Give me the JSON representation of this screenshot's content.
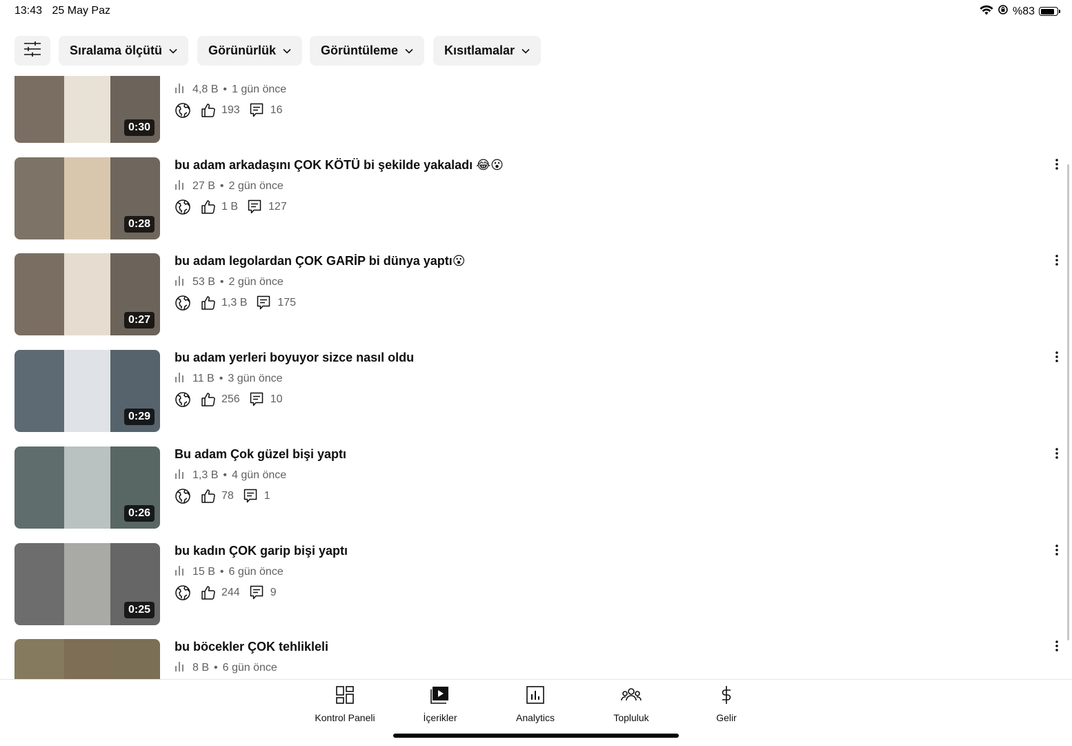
{
  "status_bar": {
    "time": "13:43",
    "date": "25 May Paz",
    "battery": "%83",
    "battery_level": 0.83
  },
  "filters": [
    {
      "label": "Sıralama ölçütü"
    },
    {
      "label": "Görünürlük"
    },
    {
      "label": "Görüntüleme"
    },
    {
      "label": "Kısıtlamalar"
    }
  ],
  "videos": [
    {
      "title": "",
      "duration": "0:30",
      "views": "4,8 B",
      "age": "1 gün önce",
      "likes": "193",
      "comments": "16",
      "thumb_colors": [
        "#7a6e62",
        "#e8e1d6",
        "#6c635a"
      ]
    },
    {
      "title": "bu adam arkadaşını ÇOK KÖTÜ bi şekilde yakaladı 😂😮",
      "duration": "0:28",
      "views": "27 B",
      "age": "2 gün önce",
      "likes": "1 B",
      "comments": "127",
      "thumb_colors": [
        "#7d7366",
        "#d9c7ad",
        "#6f675d"
      ]
    },
    {
      "title": "bu adam legolardan ÇOK GARİP bi dünya yaptı😮",
      "duration": "0:27",
      "views": "53 B",
      "age": "2 gün önce",
      "likes": "1,3 B",
      "comments": "175",
      "thumb_colors": [
        "#7a6e62",
        "#e6ddd0",
        "#6c635a"
      ]
    },
    {
      "title": "bu adam yerleri boyuyor sizce nasıl oldu",
      "duration": "0:29",
      "views": "11 B",
      "age": "3 gün önce",
      "likes": "256",
      "comments": "10",
      "thumb_colors": [
        "#5d6a73",
        "#dfe3e8",
        "#56636c"
      ]
    },
    {
      "title": "Bu adam Çok güzel bişi yaptı",
      "duration": "0:26",
      "views": "1,3 B",
      "age": "4 gün önce",
      "likes": "78",
      "comments": "1",
      "thumb_colors": [
        "#5f6e6c",
        "#b9c2c0",
        "#586664"
      ]
    },
    {
      "title": "bu kadın ÇOK garip bişi yaptı",
      "duration": "0:25",
      "views": "15 B",
      "age": "6 gün önce",
      "likes": "244",
      "comments": "9",
      "thumb_colors": [
        "#6d6d6d",
        "#a9a9a6",
        "#666666"
      ]
    },
    {
      "title": "bu böcekler ÇOK tehlikleli",
      "duration": "",
      "views": "8 B",
      "age": "6 gün önce",
      "likes": "",
      "comments": "",
      "thumb_colors": [
        "#867a5e",
        "#7d6e55",
        "#7b6f55"
      ]
    }
  ],
  "nav": [
    {
      "label": "Kontrol Paneli",
      "icon": "dashboard-icon"
    },
    {
      "label": "İçerikler",
      "icon": "content-icon"
    },
    {
      "label": "Analytics",
      "icon": "analytics-icon"
    },
    {
      "label": "Topluluk",
      "icon": "community-icon"
    },
    {
      "label": "Gelir",
      "icon": "earn-icon"
    }
  ]
}
